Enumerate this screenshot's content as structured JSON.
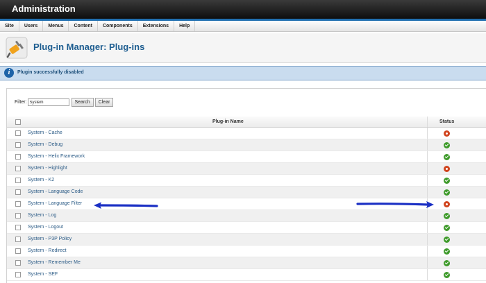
{
  "header": {
    "title": "Administration"
  },
  "menu": {
    "items": [
      "Site",
      "Users",
      "Menus",
      "Content",
      "Components",
      "Extensions",
      "Help"
    ]
  },
  "toolbar": {
    "title": "Plug-in Manager: Plug-ins",
    "icon": "plugin-icon"
  },
  "message": {
    "text": "Plugin successfully disabled",
    "icon": "info-icon"
  },
  "filter": {
    "label": "Filter:",
    "value": "System",
    "search_label": "Search",
    "clear_label": "Clear"
  },
  "table": {
    "col_name": "Plug-in Name",
    "col_status": "Status",
    "rows": [
      {
        "name": "System - Cache",
        "status": "disabled"
      },
      {
        "name": "System - Debug",
        "status": "enabled"
      },
      {
        "name": "System - Helix Framework",
        "status": "enabled"
      },
      {
        "name": "System - Highlight",
        "status": "disabled"
      },
      {
        "name": "System - K2",
        "status": "enabled"
      },
      {
        "name": "System - Language Code",
        "status": "enabled"
      },
      {
        "name": "System - Language Filter",
        "status": "disabled"
      },
      {
        "name": "System - Log",
        "status": "enabled"
      },
      {
        "name": "System - Logout",
        "status": "enabled"
      },
      {
        "name": "System - P3P Policy",
        "status": "enabled"
      },
      {
        "name": "System - Redirect",
        "status": "enabled"
      },
      {
        "name": "System - Remember Me",
        "status": "enabled"
      },
      {
        "name": "System - SEF",
        "status": "enabled"
      }
    ]
  },
  "colors": {
    "accent": "#1f6fb0",
    "enabled": "#3f9b2b",
    "disabled": "#d0441e",
    "annotation_arrow": "#1a2fc4"
  }
}
